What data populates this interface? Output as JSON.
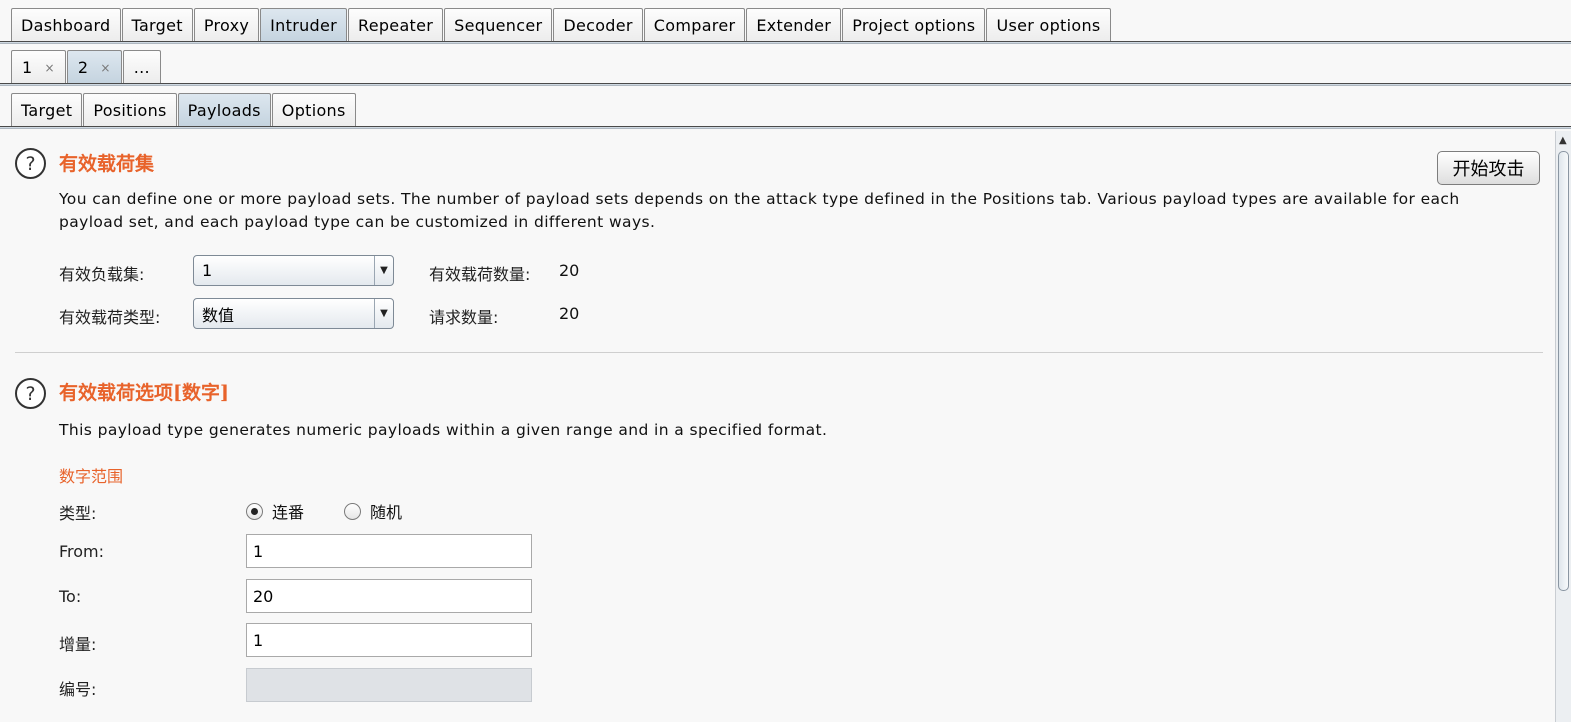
{
  "main_tabs": [
    "Dashboard",
    "Target",
    "Proxy",
    "Intruder",
    "Repeater",
    "Sequencer",
    "Decoder",
    "Comparer",
    "Extender",
    "Project options",
    "User options"
  ],
  "attack_tabs": [
    {
      "label": "1",
      "close": "×"
    },
    {
      "label": "2",
      "close": "×"
    },
    {
      "label": "..."
    }
  ],
  "sub_tabs": [
    "Target",
    "Positions",
    "Payloads",
    "Options"
  ],
  "payload_sets": {
    "help": "?",
    "title": "有效载荷集",
    "start_attack": "开始攻击",
    "description_line1": "You can define one or more payload sets. The number of payload sets depends on the attack type defined in the Positions tab. Various payload types are available for each",
    "description_line2": "payload set, and each payload type can be customized in different ways.",
    "set_label": "有效负载集:",
    "set_value": "1",
    "count_label": "有效载荷数量:",
    "count_value": "20",
    "type_label": "有效载荷类型:",
    "type_value": "数值",
    "request_label": "请求数量:",
    "request_value": "20"
  },
  "payload_options": {
    "help": "?",
    "title": "有效载荷选项[数字]",
    "description": "This payload type generates numeric payloads within a given range and in a specified format.",
    "range_heading": "数字范围",
    "type_label": "类型:",
    "radio_sequential": "连番",
    "radio_random": "随机",
    "from_label": "From:",
    "from_value": "1",
    "to_label": "To:",
    "to_value": "20",
    "step_label": "增量:",
    "step_value": "1",
    "number_label": "编号:",
    "number_value": ""
  },
  "colors": {
    "accent": "#e8632b",
    "active_tab": "#c9d7e3"
  }
}
